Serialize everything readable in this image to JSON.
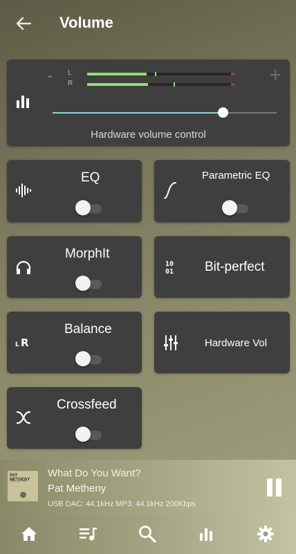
{
  "header": {
    "title": "Volume",
    "back_icon": "arrow-left-icon"
  },
  "volume": {
    "minus_label": "-",
    "plus_label": "+",
    "left_channel_label": "L",
    "right_channel_label": "R",
    "left_level": 0.4,
    "right_level": 0.41,
    "slider_value": 0.76,
    "caption": "Hardware volume control",
    "icon": "bar-chart-icon"
  },
  "tiles": {
    "eq": {
      "label": "EQ",
      "icon": "waveform-icon",
      "enabled": false
    },
    "parametric_eq": {
      "label": "Parametric EQ",
      "icon": "s-curve-icon",
      "enabled": false
    },
    "morphit": {
      "label": "MorphIt",
      "icon": "headphones-icon",
      "enabled": false
    },
    "bit_perfect": {
      "label": "Bit-perfect",
      "icon": "binary-icon"
    },
    "balance": {
      "label": "Balance",
      "icon": "lr-icon",
      "enabled": false
    },
    "hardware_vol": {
      "label": "Hardware Vol",
      "icon": "sliders-icon"
    },
    "crossfeed": {
      "label": "Crossfeed",
      "icon": "crossfeed-icon",
      "enabled": false
    }
  },
  "now_playing": {
    "title": "What Do You Want?",
    "artist": "Pat Metheny",
    "output_info": "USB DAC: 44.1kHz  MP3: 44.1kHz  200Kbps",
    "album_art_text": "PAT METHENY",
    "album_art_subtext": "TRIO 99 > 00"
  },
  "nav": {
    "items": [
      {
        "name": "home",
        "icon": "home-icon"
      },
      {
        "name": "queue",
        "icon": "playlist-icon"
      },
      {
        "name": "search",
        "icon": "search-icon"
      },
      {
        "name": "volume",
        "icon": "bar-chart-icon"
      },
      {
        "name": "settings",
        "icon": "gear-icon"
      }
    ]
  }
}
